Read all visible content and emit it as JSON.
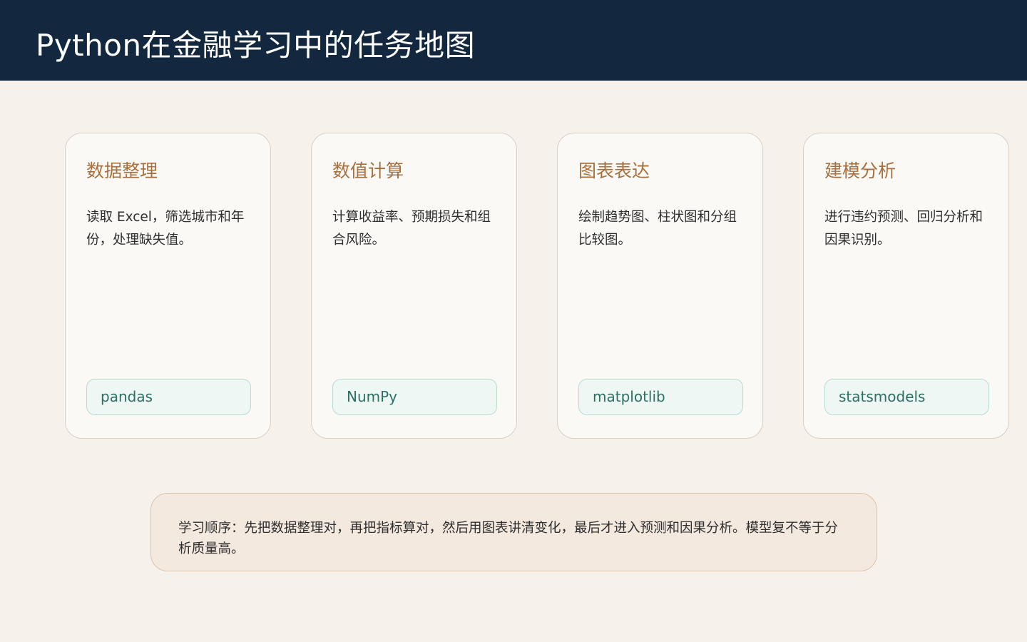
{
  "header": {
    "title": "Python在金融学习中的任务地图"
  },
  "cards": [
    {
      "title": "数据整理",
      "description": "读取 Excel，筛选城市和年份，处理缺失值。",
      "tag": "pandas"
    },
    {
      "title": "数值计算",
      "description": "计算收益率、预期损失和组合风险。",
      "tag": "NumPy"
    },
    {
      "title": "图表表达",
      "description": "绘制趋势图、柱状图和分组比较图。",
      "tag": "matplotlib"
    },
    {
      "title": "建模分析",
      "description": "进行违约预测、回归分析和因果识别。",
      "tag": "statsmodels"
    }
  ],
  "note": {
    "text": "学习顺序：先把数据整理对，再把指标算对，然后用图表讲清变化，最后才进入预测和因果分析。模型复不等于分析质量高。"
  },
  "colors": {
    "header_bg": "#13283f",
    "page_bg": "#f6f1eb",
    "card_title": "#a8703f",
    "tag_text": "#2d6f62",
    "tag_bg": "#eef7f4",
    "note_bg": "#f4e9df"
  }
}
